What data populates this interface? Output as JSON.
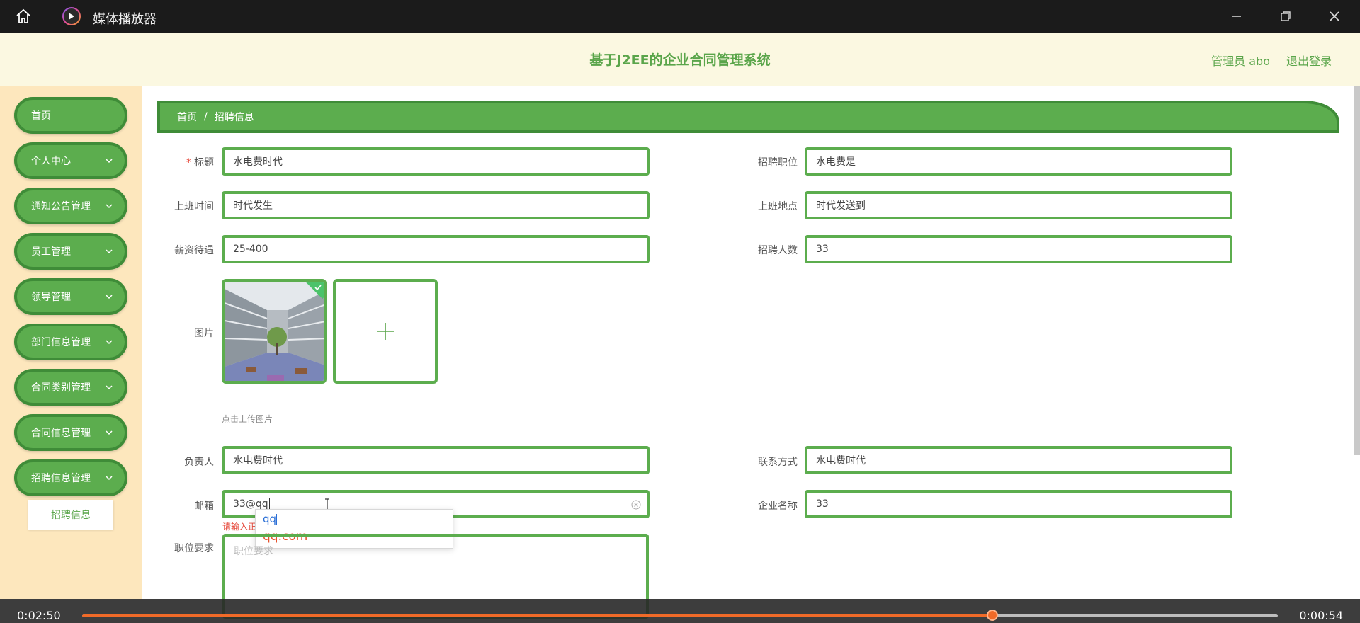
{
  "titlebar": {
    "title": "媒体播放器",
    "icons": [
      "home-icon",
      "play-icon",
      "minimize-icon",
      "restore-icon",
      "close-icon"
    ]
  },
  "header": {
    "app_title": "基于J2EE的企业合同管理系统",
    "user": "管理员 abo",
    "logout": "退出登录"
  },
  "sidebar": {
    "items": [
      {
        "label": "首页",
        "has_chevron": false
      },
      {
        "label": "个人中心",
        "has_chevron": true
      },
      {
        "label": "通知公告管理",
        "has_chevron": true
      },
      {
        "label": "员工管理",
        "has_chevron": true
      },
      {
        "label": "领导管理",
        "has_chevron": true
      },
      {
        "label": "部门信息管理",
        "has_chevron": true
      },
      {
        "label": "合同类别管理",
        "has_chevron": true
      },
      {
        "label": "合同信息管理",
        "has_chevron": true
      },
      {
        "label": "招聘信息管理",
        "has_chevron": true
      }
    ],
    "subitem": "招聘信息"
  },
  "breadcrumb": {
    "home": "首页",
    "separator": "/",
    "current": "招聘信息"
  },
  "form": {
    "title_label": "标题",
    "title_value": "水电费时代",
    "position_label": "招聘职位",
    "position_value": "水电费是",
    "worktime_label": "上班时间",
    "worktime_value": "时代发生",
    "location_label": "上班地点",
    "location_value": "时代发送到",
    "salary_label": "薪资待遇",
    "salary_value": "25-400",
    "count_label": "招聘人数",
    "count_value": "33",
    "image_label": "图片",
    "upload_hint": "点击上传图片",
    "owner_label": "负责人",
    "owner_value": "水电费时代",
    "contact_label": "联系方式",
    "contact_value": "水电费时代",
    "email_label": "邮箱",
    "email_value": "33@qq",
    "email_error": "请输入正",
    "company_label": "企业名称",
    "company_value": "33",
    "requirement_label": "职位要求",
    "requirement_placeholder": "职位要求"
  },
  "autocomplete": {
    "typed": "qq",
    "suggestion": "qq.com"
  },
  "player": {
    "elapsed": "0:02:50",
    "remaining": "0:00:54",
    "progress": 0.761
  },
  "colors": {
    "accent_green": "#5cad4e",
    "border_green": "#3f8c38",
    "sidebar_bg": "#fde7bd",
    "header_bg": "#fbf8e1",
    "error": "#e64a3c",
    "progress": "#f06a28"
  }
}
